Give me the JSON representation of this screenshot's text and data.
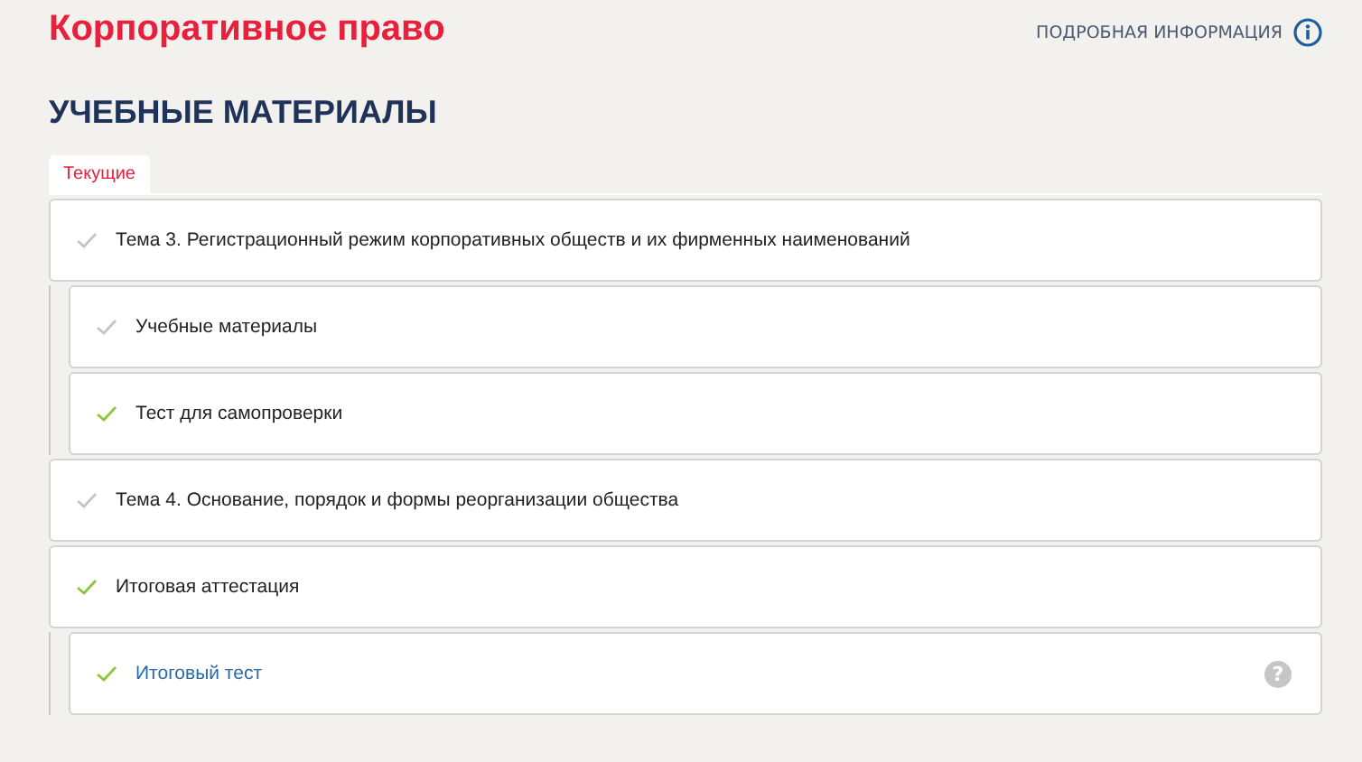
{
  "course_title": "Корпоративное право",
  "info_link": "ПОДРОБНАЯ ИНФОРМАЦИЯ",
  "section_title": "УЧЕБНЫЕ МАТЕРИАЛЫ",
  "tabs": [
    {
      "label": "Текущие",
      "selected": true
    }
  ],
  "items": [
    {
      "title": "Тема 3. Регистрационный режим корпоративных обществ и их фирменных наименований",
      "completed": false,
      "children": [
        {
          "title": "Учебные материалы",
          "completed": false,
          "link": false
        },
        {
          "title": "Тест для самопроверки",
          "completed": true,
          "link": false
        }
      ]
    },
    {
      "title": "Тема 4. Основание, порядок и формы реорганизации общества",
      "completed": false
    },
    {
      "title": "Итоговая аттестация",
      "completed": true,
      "children": [
        {
          "title": "Итоговый тест",
          "completed": true,
          "link": true,
          "help": "?"
        }
      ]
    }
  ]
}
